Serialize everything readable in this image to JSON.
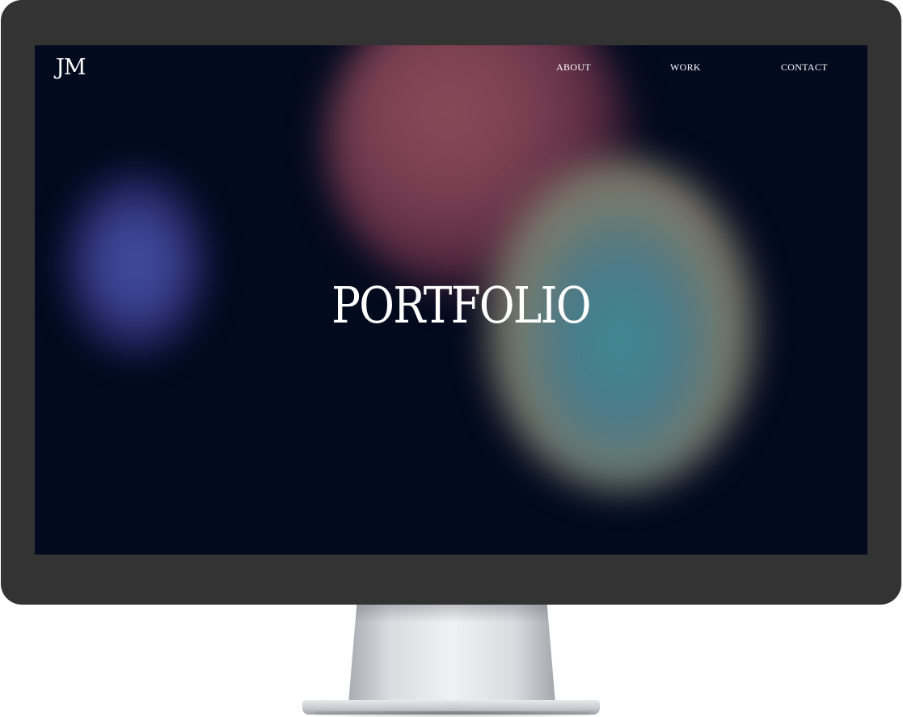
{
  "site": {
    "logo": "JM",
    "nav": {
      "about": "ABOUT",
      "work": "WORK",
      "contact": "CONTACT"
    },
    "hero": {
      "title": "PORTFOLIO"
    }
  },
  "colors": {
    "screen_background": "#020a1e",
    "bezel": "#333333",
    "text": "#ffffff",
    "blob_blue": "#3d4d9e",
    "blob_red": "#8a4a58",
    "blob_teal": "#3d8a95"
  }
}
